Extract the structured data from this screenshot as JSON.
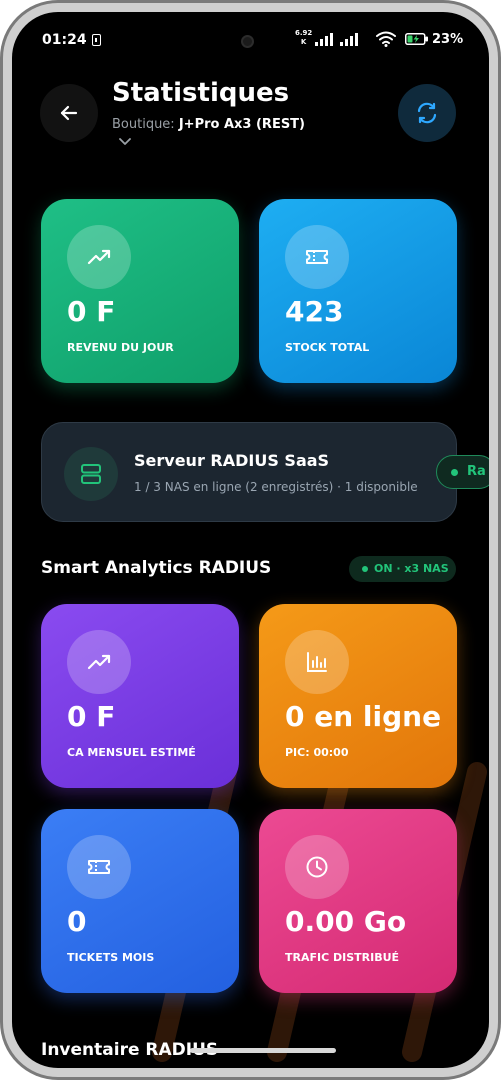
{
  "status_bar": {
    "time": "01:24",
    "speed_value": "6.92",
    "speed_unit": "K",
    "battery_percent": "23%"
  },
  "header": {
    "title": "Statistiques",
    "shop_label": "Boutique:",
    "shop_value": "J+Pro Ax3 (REST)",
    "back_icon": "arrow-left-icon",
    "refresh_icon": "refresh-icon"
  },
  "stats_top": [
    {
      "value": "0 F",
      "label": "REVENU DU JOUR",
      "icon": "trending-up-icon",
      "color": "#1fbf86"
    },
    {
      "value": "423",
      "label": "STOCK TOTAL",
      "icon": "ticket-icon",
      "color": "#1eaef2"
    }
  ],
  "radius_server": {
    "title": "Serveur RADIUS SaaS",
    "subtitle": "1 / 3 NAS en ligne (2 enregistrés) · 1 disponible",
    "badge": "Ra",
    "icon": "server-icon"
  },
  "analytics": {
    "title": "Smart Analytics RADIUS",
    "badge": "ON · x3 NAS",
    "cards": [
      {
        "value": "0 F",
        "label": "CA MENSUEL ESTIMÉ",
        "icon": "trending-up-icon",
        "color": "#8a4bf0"
      },
      {
        "value": "0 en ligne",
        "label": "PIC: 00:00",
        "icon": "bar-chart-icon",
        "color": "#f59a18"
      },
      {
        "value": "0",
        "label": "TICKETS MOIS",
        "icon": "ticket-icon",
        "color": "#3b7ef5"
      },
      {
        "value": "0.00 Go",
        "label": "TRAFIC DISTRIBUÉ",
        "icon": "clock-icon",
        "color": "#ec4a93"
      }
    ]
  },
  "inventory": {
    "title": "Inventaire RADIUS"
  }
}
